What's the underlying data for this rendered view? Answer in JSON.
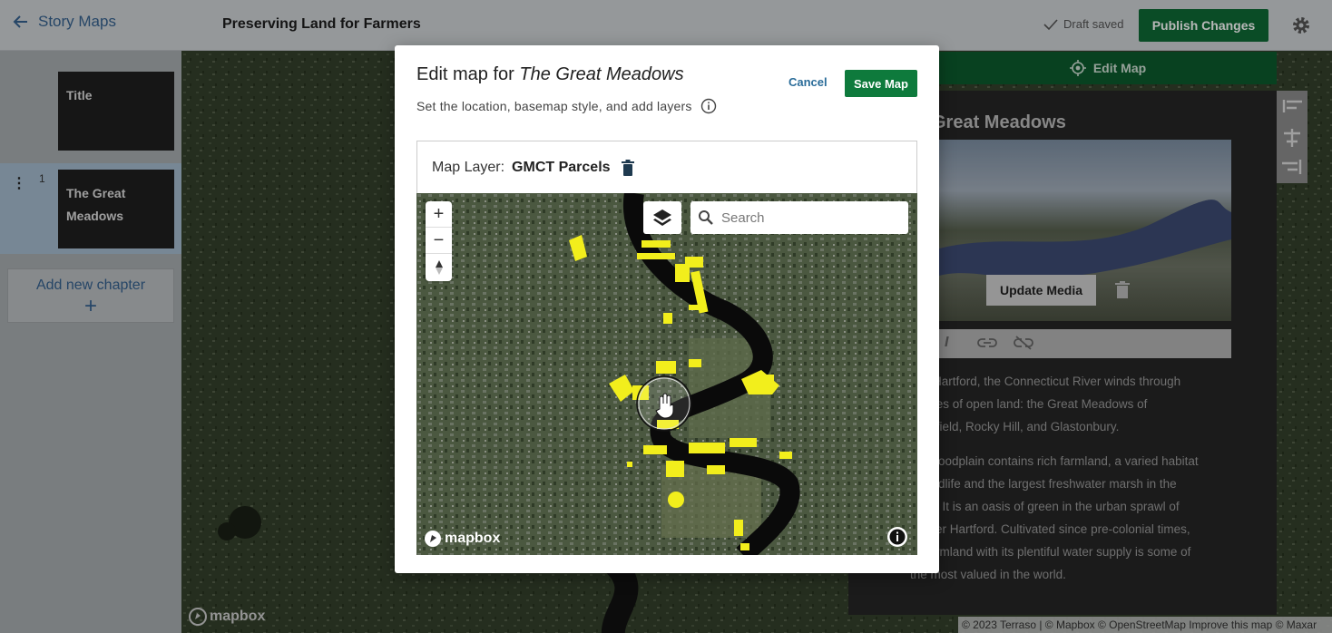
{
  "header": {
    "back_label": "Story Maps",
    "title": "Preserving Land for Farmers",
    "draft_status": "Draft saved",
    "publish_label": "Publish Changes"
  },
  "sidebar": {
    "chapters": [
      {
        "number": "",
        "label": "Title"
      },
      {
        "number": "1",
        "label": "The Great Meadows"
      }
    ],
    "add_chapter_label": "Add new chapter",
    "add_chapter_icon": "+"
  },
  "editor": {
    "edit_map_label": "Edit Map",
    "chapter_title": "Great Meadows",
    "update_media_label": "Update Media",
    "paragraph1": [
      "of Hartford, the Connecticut River winds through",
      "acres of open land: the Great Meadows of",
      "ersfield, Rocky Hill, and Glastonbury."
    ],
    "paragraph2": [
      "loodplain contains rich farmland, a varied habitat",
      "ldlife and the largest freshwater marsh in the",
      ". It is an oasis of green in the urban sprawl of",
      "er Hartford. Cultivated since pre-colonial times,",
      "rmland with its plentiful water supply is some of",
      "the most valued in the world."
    ]
  },
  "modal": {
    "title_prefix": "Edit map for",
    "title_chapter": "The Great Meadows",
    "subtitle": "Set the location, basemap style, and add layers",
    "cancel_label": "Cancel",
    "save_label": "Save Map",
    "layer_label": "Map Layer:",
    "layer_name": "GMCT Parcels",
    "search_placeholder": "Search",
    "zoom_in": "+",
    "zoom_out": "−"
  },
  "map": {
    "brand": "mapbox",
    "attribution": "© 2023 Terraso | © Mapbox © OpenStreetMap Improve this map © Maxar"
  },
  "colors": {
    "primary_green": "#0f6a35",
    "link_blue": "#35618f",
    "parcel_yellow": "#f2ee1c"
  },
  "icons": [
    "back-arrow-icon",
    "check-icon",
    "gear-icon",
    "kebab-icon",
    "plus-icon",
    "target-icon",
    "trash-icon",
    "info-icon",
    "layers-icon",
    "search-icon",
    "compass-icon",
    "hand-cursor-icon",
    "bold-icon",
    "italic-icon",
    "link-icon",
    "unlink-icon"
  ]
}
